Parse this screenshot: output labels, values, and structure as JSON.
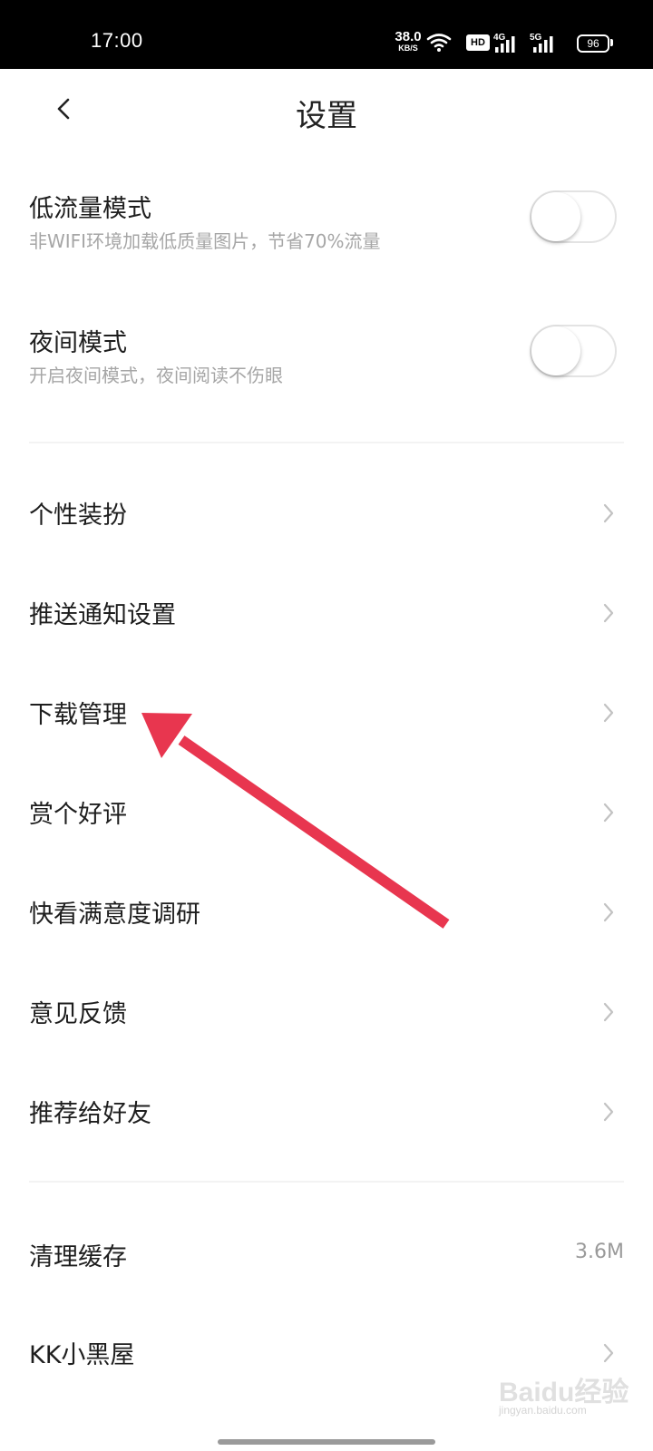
{
  "status_bar": {
    "time": "17:00",
    "net_speed_value": "38.0",
    "net_speed_unit": "KB/S",
    "hd_badge": "HD",
    "signal_1_label": "4G",
    "signal_2_label": "5G",
    "battery_level": "96",
    "icons": [
      "wifi-icon",
      "signal-icon",
      "signal-icon",
      "battery-icon"
    ]
  },
  "header": {
    "title": "设置",
    "back_icon": "chevron-left-icon"
  },
  "toggles": [
    {
      "label": "低流量模式",
      "description": "非WIFI环境加载低质量图片，节省70%流量",
      "enabled": false
    },
    {
      "label": "夜间模式",
      "description": "开启夜间模式，夜间阅读不伤眼",
      "enabled": false
    }
  ],
  "menu_items": [
    {
      "label": "个性装扮"
    },
    {
      "label": "推送通知设置"
    },
    {
      "label": "下载管理"
    },
    {
      "label": "赏个好评"
    },
    {
      "label": "快看满意度调研"
    },
    {
      "label": "意见反馈"
    },
    {
      "label": "推荐给好友"
    }
  ],
  "bottom_items": {
    "clear_cache_label": "清理缓存",
    "clear_cache_value": "3.6M",
    "dark_room_label": "KK小黑屋"
  },
  "annotation": {
    "arrow_color": "#e8364f",
    "target": "下载管理"
  },
  "watermark": {
    "main": "Baidu经验",
    "sub": "jingyan.baidu.com"
  },
  "colors": {
    "status_bar_bg": "#000000",
    "text_primary": "#1e1e1e",
    "text_secondary": "#a6a6a6",
    "divider": "#f3f3f3"
  }
}
